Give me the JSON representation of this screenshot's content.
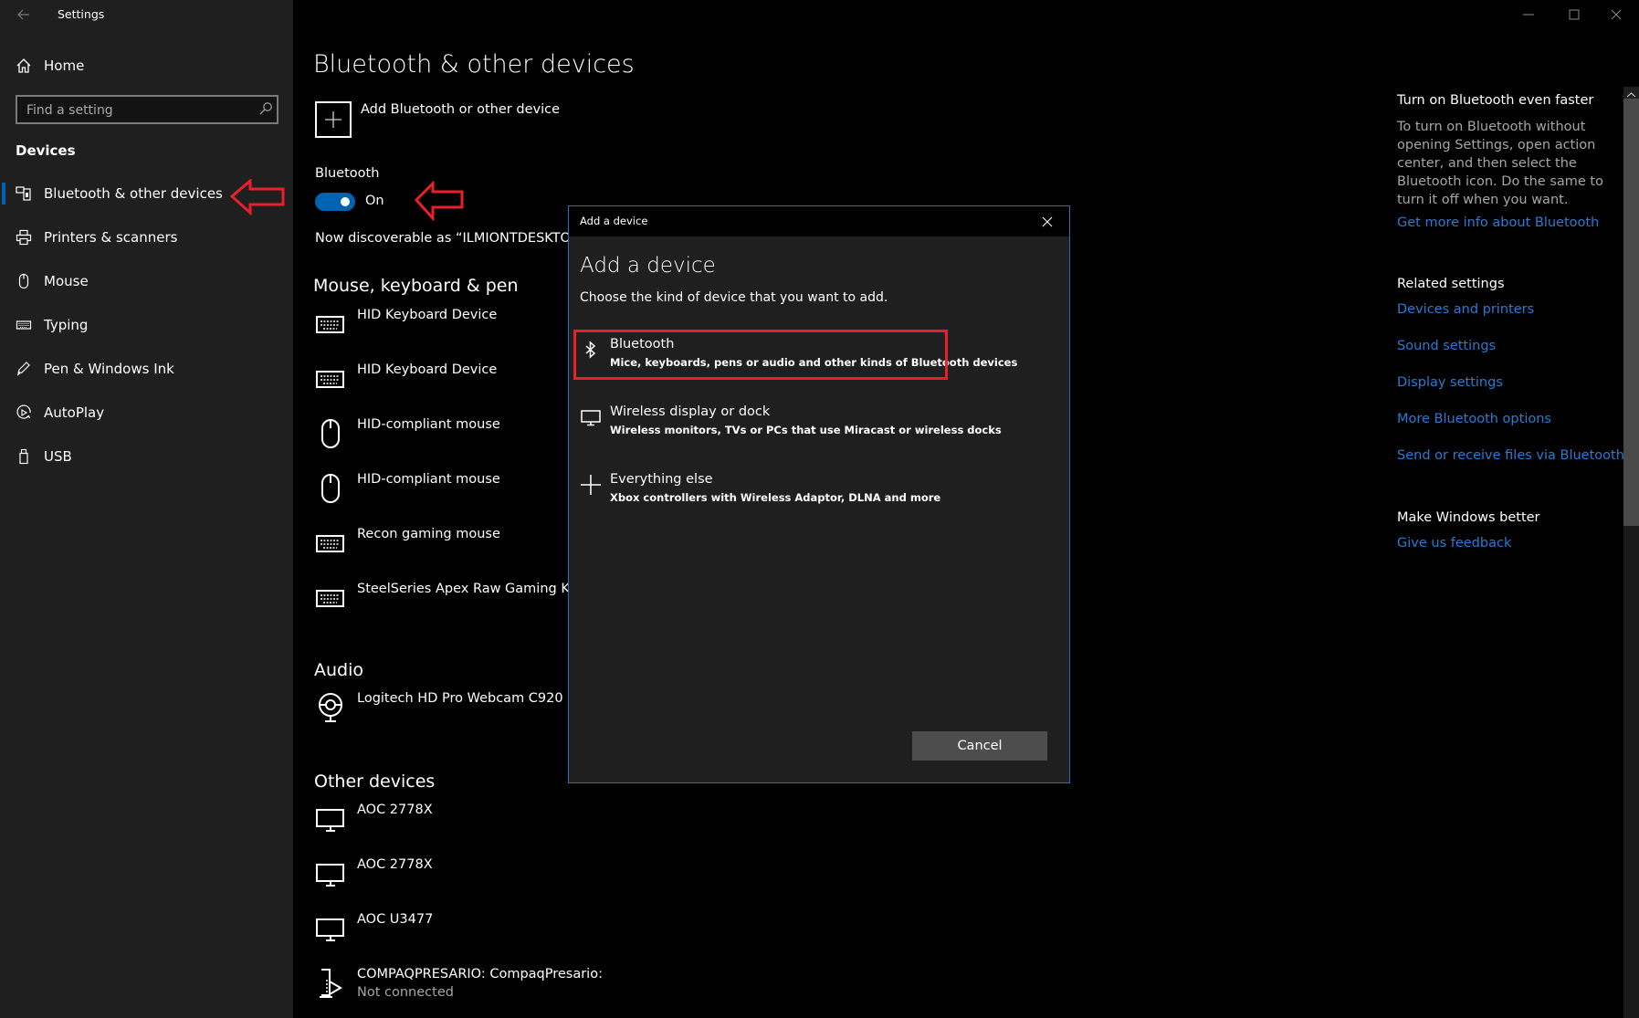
{
  "window": {
    "title": "Settings",
    "back_icon": "back-arrow-icon",
    "controls": {
      "minimize": "minimize-icon",
      "maximize": "maximize-icon",
      "close": "close-icon"
    }
  },
  "sidebar": {
    "home_label": "Home",
    "search_placeholder": "Find a setting",
    "section_label": "Devices",
    "items": [
      {
        "label": "Bluetooth & other devices",
        "icon": "bluetooth-devices-icon",
        "selected": true
      },
      {
        "label": "Printers & scanners",
        "icon": "printer-icon",
        "selected": false
      },
      {
        "label": "Mouse",
        "icon": "mouse-icon",
        "selected": false
      },
      {
        "label": "Typing",
        "icon": "keyboard-icon",
        "selected": false
      },
      {
        "label": "Pen & Windows Ink",
        "icon": "pen-icon",
        "selected": false
      },
      {
        "label": "AutoPlay",
        "icon": "autoplay-icon",
        "selected": false
      },
      {
        "label": "USB",
        "icon": "usb-icon",
        "selected": false
      }
    ]
  },
  "main": {
    "title": "Bluetooth & other devices",
    "add_device_label": "Add Bluetooth or other device",
    "bluetooth_label": "Bluetooth",
    "bluetooth_toggle": {
      "state": "On",
      "on": true
    },
    "discoverable_text": "Now discoverable as “ILMIONTDESKTOP”",
    "sections": [
      {
        "title": "Mouse, keyboard & pen",
        "devices": [
          {
            "name": "HID Keyboard Device",
            "icon": "keyboard-icon"
          },
          {
            "name": "HID Keyboard Device",
            "icon": "keyboard-icon"
          },
          {
            "name": "HID-compliant mouse",
            "icon": "mouse-icon"
          },
          {
            "name": "HID-compliant mouse",
            "icon": "mouse-icon"
          },
          {
            "name": "Recon gaming mouse",
            "icon": "keyboard-icon"
          },
          {
            "name": "SteelSeries Apex Raw Gaming Keyboard",
            "icon": "keyboard-icon"
          }
        ]
      },
      {
        "title": "Audio",
        "devices": [
          {
            "name": "Logitech HD Pro Webcam C920",
            "icon": "webcam-icon"
          }
        ]
      },
      {
        "title": "Other devices",
        "devices": [
          {
            "name": "AOC 2778X",
            "icon": "monitor-icon"
          },
          {
            "name": "AOC 2778X",
            "icon": "monitor-icon"
          },
          {
            "name": "AOC U3477",
            "icon": "monitor-icon"
          },
          {
            "name": "COMPAQPRESARIO: CompaqPresario:",
            "status": "Not connected",
            "icon": "media-device-icon"
          }
        ]
      }
    ]
  },
  "right_pane": {
    "tip_title": "Turn on Bluetooth even faster",
    "tip_text": "To turn on Bluetooth without opening Settings, open action center, and then select the Bluetooth icon. Do the same to turn it off when you want.",
    "tip_link": "Get more info about Bluetooth",
    "related_title": "Related settings",
    "related_links": [
      "Devices and printers",
      "Sound settings",
      "Display settings",
      "More Bluetooth options",
      "Send or receive files via Bluetooth"
    ],
    "feedback_title": "Make Windows better",
    "feedback_link": "Give us feedback"
  },
  "dialog": {
    "window_title": "Add a device",
    "heading": "Add a device",
    "subtitle": "Choose the kind of device that you want to add.",
    "options": [
      {
        "title": "Bluetooth",
        "description": "Mice, keyboards, pens or audio and other kinds of Bluetooth devices",
        "icon": "bluetooth-icon",
        "highlighted": true
      },
      {
        "title": "Wireless display or dock",
        "description": "Wireless monitors, TVs or PCs that use Miracast or wireless docks",
        "icon": "monitor-icon",
        "highlighted": false
      },
      {
        "title": "Everything else",
        "description": "Xbox controllers with Wireless Adaptor, DLNA and more",
        "icon": "plus-icon",
        "highlighted": false
      }
    ],
    "cancel_label": "Cancel"
  },
  "annotations": {
    "color": "#e8202a",
    "arrows": [
      "sidebar-bluetooth-item",
      "bluetooth-toggle"
    ],
    "highlight_box": "bluetooth-option"
  },
  "colors": {
    "accent": "#0063b1",
    "link": "#2b7bd1",
    "sidebar_bg": "#1f1f1f",
    "main_bg": "#000000",
    "dialog_bg": "#1f1f1f",
    "dialog_border": "#2b6fb6",
    "annotation": "#e8202a"
  }
}
